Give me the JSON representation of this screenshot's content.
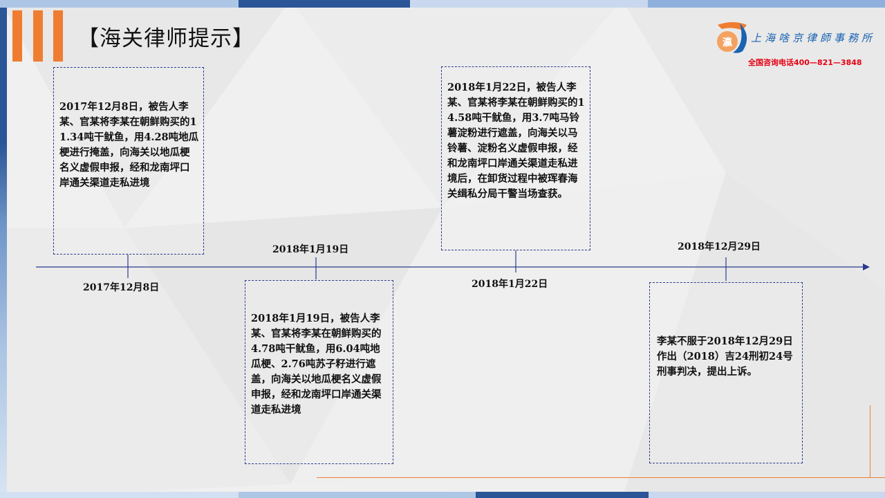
{
  "header": {
    "title": "【海关律师提示】",
    "firm_name": "上海啥京律師事務所",
    "hotline": "全国咨询电话400—821—3848"
  },
  "logo": {
    "glyph": "瀛"
  },
  "colors": {
    "accent_orange": "#ef7d31",
    "dashed_border": "#2b3a8c",
    "timeline": "#2b3a8c",
    "firm_blue": "#1a63b0",
    "hotline_red": "#e60012"
  },
  "timeline": {
    "events": [
      {
        "date": "2017年12月8日",
        "text": "2017年12月8日，被告人李某、官某将李某在朝鲜购买的11.34吨干鱿鱼，用4.28吨地瓜梗进行掩盖，向海关以地瓜梗名义虚假申报，经和龙南坪口岸通关渠道走私进境"
      },
      {
        "date": "2018年1月19日",
        "text": "2018年1月19日，被告人李某、官某将李某在朝鲜购买的4.78吨干鱿鱼，用6.04吨地瓜梗、2.76吨苏子籽进行遮盖，向海关以地瓜梗名义虚假申报，经和龙南坪口岸通关渠道走私进境"
      },
      {
        "date": "2018年1月22日",
        "text": "2018年1月22日，被告人李某、官某将李某在朝鲜购买的14.58吨干鱿鱼，用3.7吨马铃薯淀粉进行遮盖，向海关以马铃薯、淀粉名义虚假申报，经和龙南坪口岸通关渠道走私进境后，在卸货过程中被珲春海关缉私分局干警当场查获。"
      },
      {
        "date": "2018年12月29日",
        "text": "李某不服于2018年12月29日作出（2018）吉24刑初24号刑事判决，提出上诉。"
      }
    ]
  }
}
